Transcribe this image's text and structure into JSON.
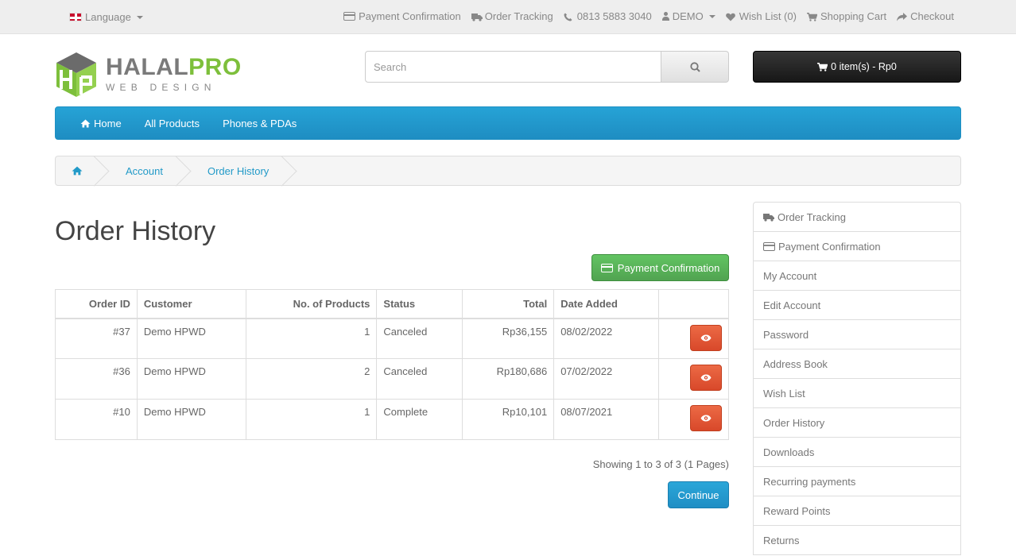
{
  "topbar": {
    "language_label": "Language",
    "links": [
      {
        "label": "Payment Confirmation",
        "icon": "credit-card-icon"
      },
      {
        "label": "Order Tracking",
        "icon": "truck-icon"
      },
      {
        "label": "0813 5883 3040",
        "icon": "phone-icon"
      },
      {
        "label": "DEMO",
        "icon": "user-icon"
      },
      {
        "label": "Wish List (0)",
        "icon": "heart-icon"
      },
      {
        "label": "Shopping Cart",
        "icon": "cart-icon"
      },
      {
        "label": "Checkout",
        "icon": "share-icon"
      }
    ]
  },
  "logo": {
    "title_main": "HALAL",
    "title_accent": "PRO",
    "subtitle": "WEB DESIGN"
  },
  "search": {
    "placeholder": "Search"
  },
  "cart": {
    "label": "0 item(s) - Rp0"
  },
  "nav": {
    "items": [
      "Home",
      "All Products",
      "Phones & PDAs"
    ]
  },
  "breadcrumb": {
    "items": [
      "Account",
      "Order History"
    ]
  },
  "page": {
    "title": "Order History",
    "payment_button": "Payment Confirmation",
    "showing": "Showing 1 to 3 of 3 (1 Pages)",
    "continue": "Continue"
  },
  "table": {
    "headers": [
      "Order ID",
      "Customer",
      "No. of Products",
      "Status",
      "Total",
      "Date Added"
    ],
    "rows": [
      {
        "id": "#37",
        "customer": "Demo HPWD",
        "products": "1",
        "status": "Canceled",
        "total": "Rp36,155",
        "date": "08/02/2022"
      },
      {
        "id": "#36",
        "customer": "Demo HPWD",
        "products": "2",
        "status": "Canceled",
        "total": "Rp180,686",
        "date": "07/02/2022"
      },
      {
        "id": "#10",
        "customer": "Demo HPWD",
        "products": "1",
        "status": "Complete",
        "total": "Rp10,101",
        "date": "08/07/2021"
      }
    ]
  },
  "sidebar": {
    "items": [
      "Order Tracking",
      "Payment Confirmation",
      "My Account",
      "Edit Account",
      "Password",
      "Address Book",
      "Wish List",
      "Order History",
      "Downloads",
      "Recurring payments",
      "Reward Points",
      "Returns"
    ]
  },
  "colors": {
    "nav_blue": "#229ac8",
    "green": "#5bb75b",
    "orange_red": "#e0552f",
    "logo_green": "#7dbf3b"
  }
}
